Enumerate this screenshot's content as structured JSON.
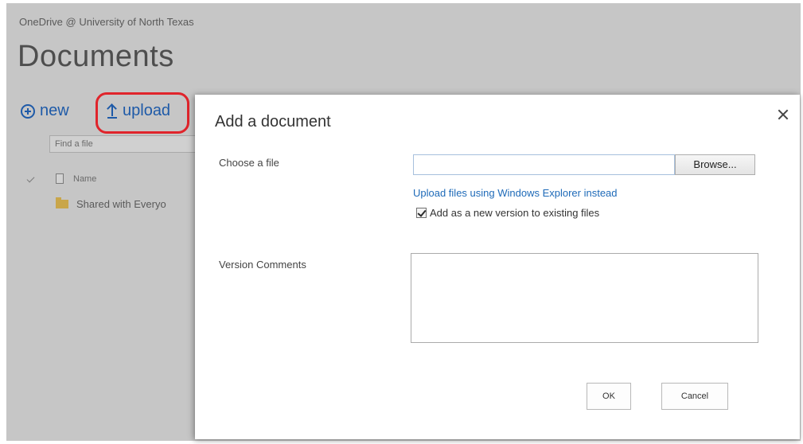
{
  "background": {
    "site_title": "OneDrive @ University of North Texas",
    "page_title": "Documents",
    "commands": {
      "new_label": "new",
      "upload_label": "upload"
    },
    "search": {
      "placeholder": "Find a file"
    },
    "list": {
      "header_name": "Name",
      "rows": [
        {
          "name": "Shared with Everyo"
        }
      ]
    }
  },
  "dialog": {
    "title": "Add a document",
    "choose_file_label": "Choose a file",
    "file_input_value": "",
    "browse_label": "Browse...",
    "explorer_link": "Upload files using Windows Explorer instead",
    "add_version_label": "Add as a new version to existing files",
    "add_version_checked": true,
    "version_comments_label": "Version Comments",
    "version_comments_value": "",
    "ok_label": "OK",
    "cancel_label": "Cancel"
  },
  "colors": {
    "accent": "#1e5aa8",
    "link": "#1e6ab8",
    "highlight": "#e0242b",
    "overlay_bg": "#c6c6c6"
  },
  "icons": {
    "new": "plus-circle-icon",
    "upload": "upload-arrow-icon",
    "close": "close-icon",
    "check": "checkmark-icon",
    "document": "document-icon",
    "folder": "folder-icon"
  }
}
